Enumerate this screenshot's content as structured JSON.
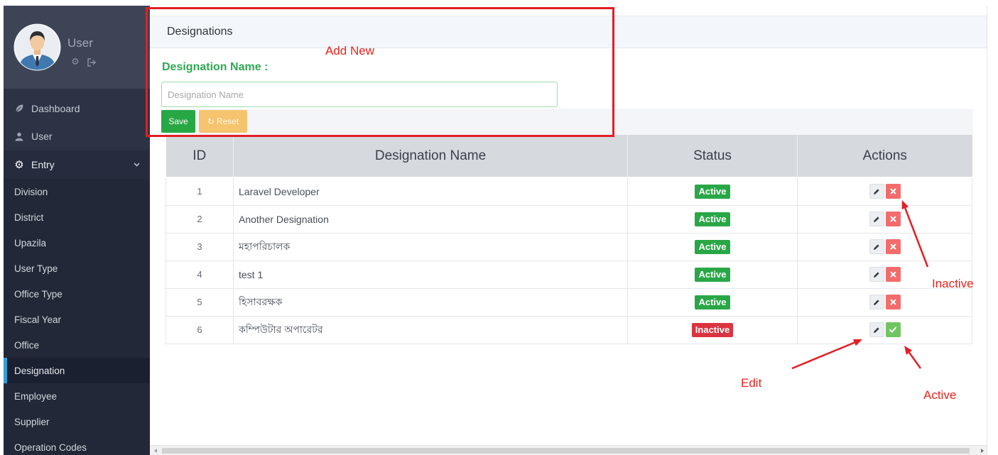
{
  "sidebar": {
    "user": {
      "name": "User"
    },
    "user_tools": [
      {
        "icon": "gear-icon"
      },
      {
        "icon": "sign-out-icon"
      }
    ],
    "menu": [
      {
        "label": "Dashboard",
        "icon": "leaf-icon"
      },
      {
        "label": "User",
        "icon": "user-icon"
      },
      {
        "label": "Entry",
        "icon": "gear-icon",
        "expanded": true
      }
    ],
    "submenu": [
      {
        "label": "Division"
      },
      {
        "label": "District"
      },
      {
        "label": "Upazila"
      },
      {
        "label": "User Type"
      },
      {
        "label": "Office Type"
      },
      {
        "label": "Fiscal Year"
      },
      {
        "label": "Office"
      },
      {
        "label": "Designation",
        "active": true
      },
      {
        "label": "Employee"
      },
      {
        "label": "Supplier"
      },
      {
        "label": "Operation Codes"
      }
    ]
  },
  "page": {
    "title": "Designations"
  },
  "form": {
    "field_label": "Designation Name :",
    "placeholder": "Designation Name",
    "value": "",
    "save_label": "Save",
    "reset_label": "Reset",
    "reset_icon": "refresh-icon"
  },
  "table": {
    "headers": {
      "id": "ID",
      "name": "Designation Name",
      "status": "Status",
      "actions": "Actions"
    },
    "rows": [
      {
        "id": "1",
        "name": "Laravel Developer",
        "status": "Active",
        "edit_icon": "pencil-icon",
        "toggle_icon": "times-icon"
      },
      {
        "id": "2",
        "name": "Another Designation",
        "status": "Active",
        "edit_icon": "pencil-icon",
        "toggle_icon": "times-icon"
      },
      {
        "id": "3",
        "name": "মহাপরিচালক",
        "status": "Active",
        "edit_icon": "pencil-icon",
        "toggle_icon": "times-icon"
      },
      {
        "id": "4",
        "name": "test 1",
        "status": "Active",
        "edit_icon": "pencil-icon",
        "toggle_icon": "times-icon"
      },
      {
        "id": "5",
        "name": "হিসাবরক্ষক",
        "status": "Active",
        "edit_icon": "pencil-icon",
        "toggle_icon": "times-icon"
      },
      {
        "id": "6",
        "name": "কম্পিউটার অপারেটর",
        "status": "Inactive",
        "edit_icon": "pencil-icon",
        "toggle_icon": "check-icon"
      }
    ]
  },
  "annotations": {
    "add_new": "Add New",
    "inactive": "Inactive",
    "edit": "Edit",
    "active": "Active"
  },
  "colors": {
    "sidebar_bg": "#2c3345",
    "sidebar_active_accent": "#2f9fd6",
    "form_label": "#30a852",
    "save_button": "#28a745",
    "reset_button": "#f6c46e",
    "status_active": "#29a747",
    "status_inactive": "#db3440",
    "delete_button": "#f46b6b",
    "activate_button": "#70c562",
    "annotation": "#e31e24"
  }
}
